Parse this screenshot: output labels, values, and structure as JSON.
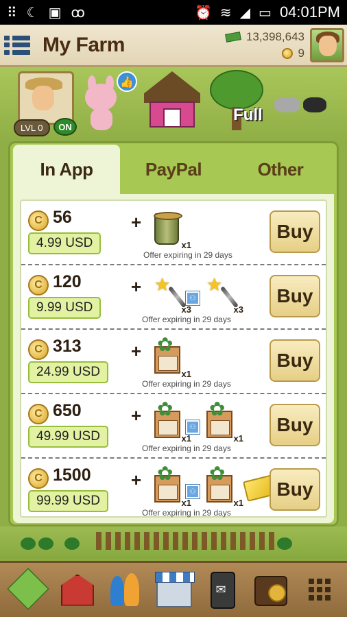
{
  "status_bar": {
    "icons_left": [
      "grid-icon",
      "moon-icon",
      "image-icon",
      "voicemail-icon"
    ],
    "icons_right": [
      "alarm-icon",
      "wifi-icon",
      "signal-icon",
      "battery-icon"
    ],
    "time": "04:01PM"
  },
  "header": {
    "title": "My Farm",
    "cash": "13,398,643",
    "coins": "9"
  },
  "scene": {
    "level": "LVL 0",
    "online": "ON",
    "treehouse_status": "Full"
  },
  "tabs": [
    {
      "label": "In App",
      "active": true
    },
    {
      "label": "PayPal",
      "active": false
    },
    {
      "label": "Other",
      "active": false
    }
  ],
  "offers": [
    {
      "coins": "56",
      "price": "4.99 USD",
      "plus": "+",
      "items": [
        {
          "icon": "bucket-icon",
          "qty": "x1"
        }
      ],
      "expire": "Offer expiring in 29 days",
      "buy": "Buy"
    },
    {
      "coins": "120",
      "price": "9.99 USD",
      "plus": "+",
      "items": [
        {
          "icon": "magic-wand-icon",
          "qty": "x3"
        },
        {
          "icon": "magic-wand-icon",
          "qty": "x3"
        }
      ],
      "expire": "Offer expiring in 29 days",
      "buy": "Buy"
    },
    {
      "coins": "313",
      "price": "24.99 USD",
      "plus": "+",
      "items": [
        {
          "icon": "plant-crate-icon",
          "qty": "x1"
        }
      ],
      "expire": "Offer expiring in 29 days",
      "buy": "Buy"
    },
    {
      "coins": "650",
      "price": "49.99 USD",
      "plus": "+",
      "items": [
        {
          "icon": "plant-crate-icon",
          "qty": "x1"
        },
        {
          "icon": "plant-crate-icon",
          "qty": "x1"
        }
      ],
      "expire": "Offer expiring in 29 days",
      "buy": "Buy"
    },
    {
      "coins": "1500",
      "price": "99.99 USD",
      "plus": "+",
      "items": [
        {
          "icon": "plant-crate-icon",
          "qty": "x1"
        },
        {
          "icon": "plant-crate-icon",
          "qty": "x1"
        },
        {
          "icon": "gold-tickets-icon",
          "qty": "x1"
        }
      ],
      "expire": "Offer expiring in 29 days",
      "buy": "Buy"
    }
  ],
  "dock": [
    "field-icon",
    "barn-icon",
    "friends-icon",
    "shop-icon",
    "messages-icon",
    "wallet-icon",
    "apps-grid-icon"
  ],
  "colors": {
    "dialog_green": "#a7c852",
    "panel_bg": "#eef5d6",
    "price_bg": "#e3f2a2",
    "buy_bg": "#f0dc9c",
    "title_brown": "#4a2c13"
  }
}
